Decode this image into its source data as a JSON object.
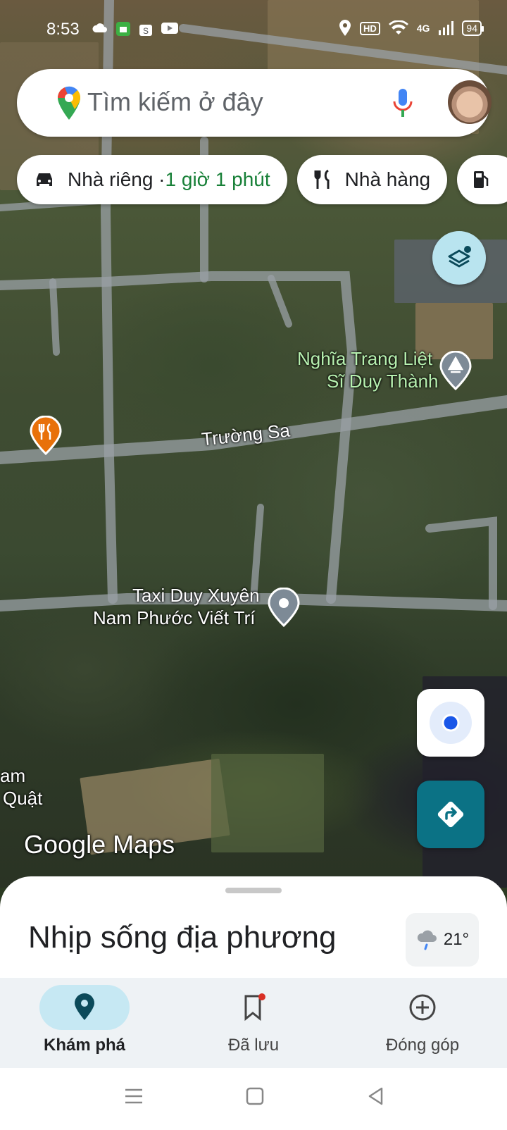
{
  "status_bar": {
    "time": "8:53",
    "battery": "94",
    "network": "4G",
    "hd": "HD"
  },
  "search": {
    "placeholder": "Tìm kiếm ở đây"
  },
  "chips": [
    {
      "label": "Nhà riêng · ",
      "eta": "1 giờ 1 phút",
      "icon": "car-icon"
    },
    {
      "label": "Nhà hàng",
      "icon": "restaurant-icon"
    },
    {
      "label": "",
      "icon": "gas-station-icon"
    }
  ],
  "map": {
    "labels": {
      "cemetery_line1": "Nghĩa Trang Liệt",
      "cemetery_line2": "Sĩ Duy Thành",
      "road": "Trường Sa",
      "taxi_line1": "Taxi Duy Xuyên",
      "taxi_line2": "Nam Phước Viết Trí",
      "edge_line1": "am",
      "edge_line2": "Quật"
    },
    "watermark": "Google Maps"
  },
  "sheet": {
    "title": "Nhịp sống địa phương",
    "temperature": "21°"
  },
  "bottom_nav": [
    {
      "label": "Khám phá",
      "icon": "explore-pin-icon",
      "active": true
    },
    {
      "label": "Đã lưu",
      "icon": "bookmark-icon",
      "active": false
    },
    {
      "label": "Đóng góp",
      "icon": "add-circle-icon",
      "active": false
    }
  ],
  "colors": {
    "accent": "#0b7285",
    "eta_green": "#188038",
    "active_nav": "#c6e8f3",
    "my_location": "#1a57e8"
  }
}
